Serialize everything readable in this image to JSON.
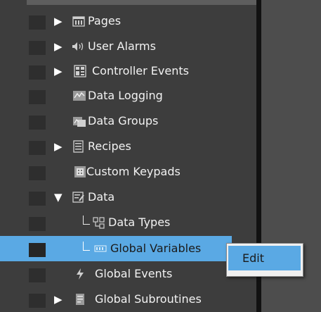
{
  "tree": {
    "items": [
      {
        "label": "Pages",
        "icon": "pages-icon",
        "expander": "▶"
      },
      {
        "label": "User Alarms",
        "icon": "speaker-icon",
        "expander": "▶"
      },
      {
        "label": "Controller Events",
        "icon": "controller-icon",
        "expander": "▶"
      },
      {
        "label": "Data Logging",
        "icon": "data-logging-icon"
      },
      {
        "label": "Data Groups",
        "icon": "data-groups-icon"
      },
      {
        "label": "Recipes",
        "icon": "recipes-icon",
        "expander": "▶"
      },
      {
        "label": "Custom Keypads",
        "icon": "keypad-icon"
      },
      {
        "label": "Data",
        "icon": "data-icon",
        "expander": "▼"
      },
      {
        "label": "Data Types",
        "icon": "data-types-icon"
      },
      {
        "label": "Global Variables",
        "icon": "variables-icon",
        "selected": true
      },
      {
        "label": "Global Events",
        "icon": "lightning-icon"
      },
      {
        "label": "Global Subroutines",
        "icon": "subroutines-icon",
        "expander": "▶"
      }
    ]
  },
  "context_menu": {
    "items": [
      {
        "label": "Edit"
      }
    ]
  },
  "colors": {
    "selection": "#5aa9e4",
    "panel": "#3d3d3d",
    "splitter": "#121212"
  }
}
